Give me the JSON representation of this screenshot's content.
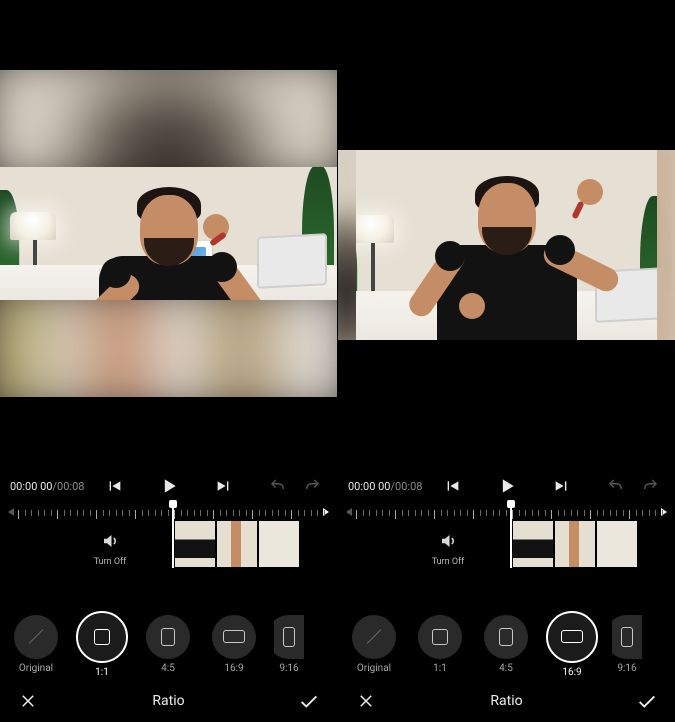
{
  "panes": [
    {
      "id": "left",
      "preview_aspect": "1:1",
      "time_current": "00:00 00",
      "time_total": "00:08",
      "audio_label": "Turn Off",
      "ratio_options": [
        {
          "key": "original",
          "label": "Original",
          "shape": "diag",
          "selected": false
        },
        {
          "key": "1_1",
          "label": "1:1",
          "shape": "sq",
          "selected": true
        },
        {
          "key": "4_5",
          "label": "4:5",
          "shape": "p45",
          "selected": false
        },
        {
          "key": "16_9",
          "label": "16:9",
          "shape": "l169",
          "selected": false
        },
        {
          "key": "9_16",
          "label": "9:16",
          "shape": "p916",
          "selected": false
        }
      ],
      "footer_title": "Ratio"
    },
    {
      "id": "right",
      "preview_aspect": "16:9",
      "time_current": "00:00 00",
      "time_total": "00:08",
      "audio_label": "Turn Off",
      "ratio_options": [
        {
          "key": "original",
          "label": "Original",
          "shape": "diag",
          "selected": false
        },
        {
          "key": "1_1",
          "label": "1:1",
          "shape": "sq",
          "selected": false
        },
        {
          "key": "4_5",
          "label": "4:5",
          "shape": "p45",
          "selected": false
        },
        {
          "key": "16_9",
          "label": "16:9",
          "shape": "l169",
          "selected": true
        },
        {
          "key": "9_16",
          "label": "9:16",
          "shape": "p916",
          "selected": false
        }
      ],
      "footer_title": "Ratio"
    }
  ],
  "icons": {
    "prev": "prev-frame-icon",
    "play": "play-icon",
    "next": "next-frame-icon",
    "undo": "undo-icon",
    "redo": "redo-icon",
    "speaker": "speaker-icon",
    "close": "close-icon",
    "confirm": "check-icon"
  }
}
